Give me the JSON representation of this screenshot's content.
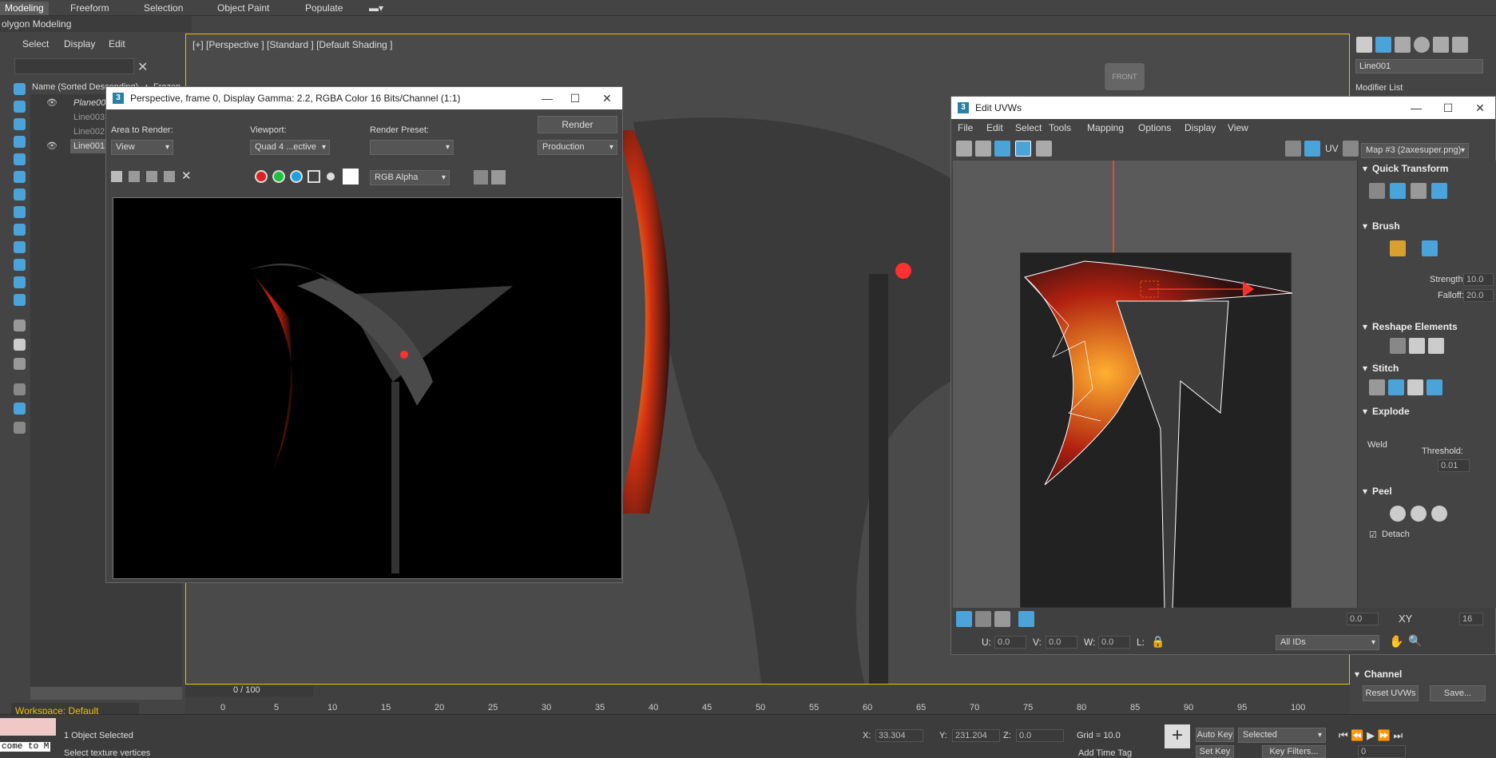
{
  "ribbon": {
    "tabs": [
      "Modeling",
      "Freeform",
      "Selection",
      "Object Paint",
      "Populate"
    ],
    "subtitle": "olygon Modeling"
  },
  "scene_explorer": {
    "menu": [
      "Select",
      "Display",
      "Edit"
    ],
    "column_header": "Name (Sorted Descending)",
    "frozen_label": "▲ Frozen",
    "items": [
      "Plane001",
      "Line003",
      "Line002",
      "Line001"
    ],
    "workspace_label": "Workspace: Default"
  },
  "viewport": {
    "label": "[+] [Perspective ] [Standard ] [Default Shading ]",
    "frame_counter": "0 / 100"
  },
  "render_window": {
    "title": "Perspective, frame 0, Display Gamma: 2.2, RGBA Color 16 Bits/Channel (1:1)",
    "area_label": "Area to Render:",
    "area_value": "View",
    "viewport_label": "Viewport:",
    "viewport_value": "Quad 4 ...ective",
    "preset_label": "Render Preset:",
    "preset_value": "",
    "render_button": "Render",
    "production_value": "Production",
    "channel_value": "RGB Alpha"
  },
  "uv_editor": {
    "title": "Edit UVWs",
    "menu": [
      "File",
      "Edit",
      "Select",
      "Tools",
      "Mapping",
      "Options",
      "Display",
      "View"
    ],
    "uv_label": "UV",
    "map_value": "Map #3 (2axesuper.png)",
    "quick_transform": "Quick Transform",
    "brush": "Brush",
    "strength_label": "Strength:",
    "strength_value": "10.0",
    "falloff_label": "Falloff:",
    "falloff_value": "20.0",
    "reshape": "Reshape Elements",
    "stitch": "Stitch",
    "explode": "Explode",
    "weld": "Weld",
    "threshold_label": "Threshold:",
    "threshold_value": "0.01",
    "peel": "Peel",
    "detach": "Detach",
    "u_label": "U:",
    "u_value": "0.0",
    "v_label": "V:",
    "v_value": "0.0",
    "w_label": "W:",
    "w_value": "0.0",
    "l_label": "L:",
    "angle_value": "0.0",
    "xy_label": "XY",
    "grid_count": "16",
    "ids_value": "All IDs"
  },
  "modify_panel": {
    "object_name": "Line001",
    "modifier_list": "Modifier List",
    "channel": "Channel",
    "reset_uvws": "Reset UVWs",
    "save": "Save..."
  },
  "timeline": {
    "ticks": [
      "0",
      "5",
      "10",
      "15",
      "20",
      "25",
      "30",
      "35",
      "40",
      "45",
      "50",
      "55",
      "60",
      "65",
      "70",
      "75",
      "80",
      "85",
      "90",
      "95",
      "100"
    ]
  },
  "status": {
    "selected": "1 Object Selected",
    "prompt": "Select texture vertices",
    "script_text": "come to M",
    "x_label": "X:",
    "x_value": "33.304",
    "y_label": "Y:",
    "y_value": "231.204",
    "z_label": "Z:",
    "z_value": "0.0",
    "grid": "Grid = 10.0",
    "auto_key": "Auto Key",
    "selected_dd": "Selected",
    "set_key": "Set Key",
    "key_filters": "Key Filters...",
    "add_time_tag": "Add Time Tag",
    "frame_value": "0"
  },
  "colors": {
    "accent": "#2a9fd6",
    "viewport_border": "#e6c200",
    "red_accent": "#ff3030"
  }
}
